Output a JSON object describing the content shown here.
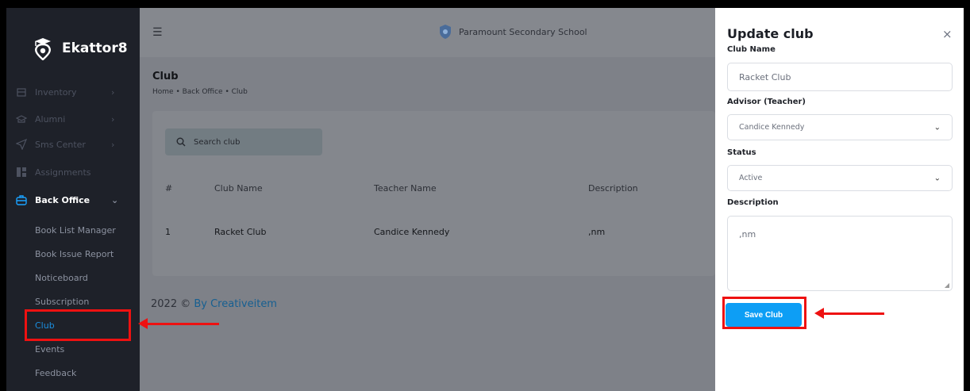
{
  "brand": {
    "name": "Ekattor8"
  },
  "sidebar": {
    "items": [
      {
        "label": "Inventory",
        "icon": "inventory-icon",
        "chevron": "›"
      },
      {
        "label": "Alumni",
        "icon": "alumni-icon",
        "chevron": "›"
      },
      {
        "label": "Sms Center",
        "icon": "send-icon",
        "chevron": "›"
      },
      {
        "label": "Assignments",
        "icon": "assignments-icon"
      },
      {
        "label": "Back Office",
        "icon": "briefcase-icon",
        "chevron": "⌄"
      }
    ],
    "sub_items": [
      "Book List Manager",
      "Book Issue Report",
      "Noticeboard",
      "Subscription",
      "Club",
      "Events",
      "Feedback"
    ]
  },
  "header": {
    "menu_icon": "hamburger-icon",
    "school": "Paramount Secondary School"
  },
  "page": {
    "title": "Club",
    "breadcrumb": "Home • Back Office • Club"
  },
  "search": {
    "placeholder": "Search club"
  },
  "table": {
    "columns": [
      "#",
      "Club Name",
      "Teacher Name",
      "Description"
    ],
    "rows": [
      {
        "num": "1",
        "club": "Racket Club",
        "teacher": "Candice Kennedy",
        "description": ",nm"
      }
    ]
  },
  "footer": {
    "year": "2022 ©",
    "link": "By Creativeitem"
  },
  "panel": {
    "title": "Update club",
    "close": "×",
    "club_name_label": "Club Name",
    "club_name_value": "Racket Club",
    "advisor_label": "Advisor (Teacher)",
    "advisor_value": "Candice Kennedy",
    "status_label": "Status",
    "status_value": "Active",
    "description_label": "Description",
    "description_value": ",nm",
    "save_label": "Save Club"
  },
  "colors": {
    "accent": "#0d9ef5",
    "highlight": "#ee1111",
    "sidebar": "#1e2129"
  }
}
